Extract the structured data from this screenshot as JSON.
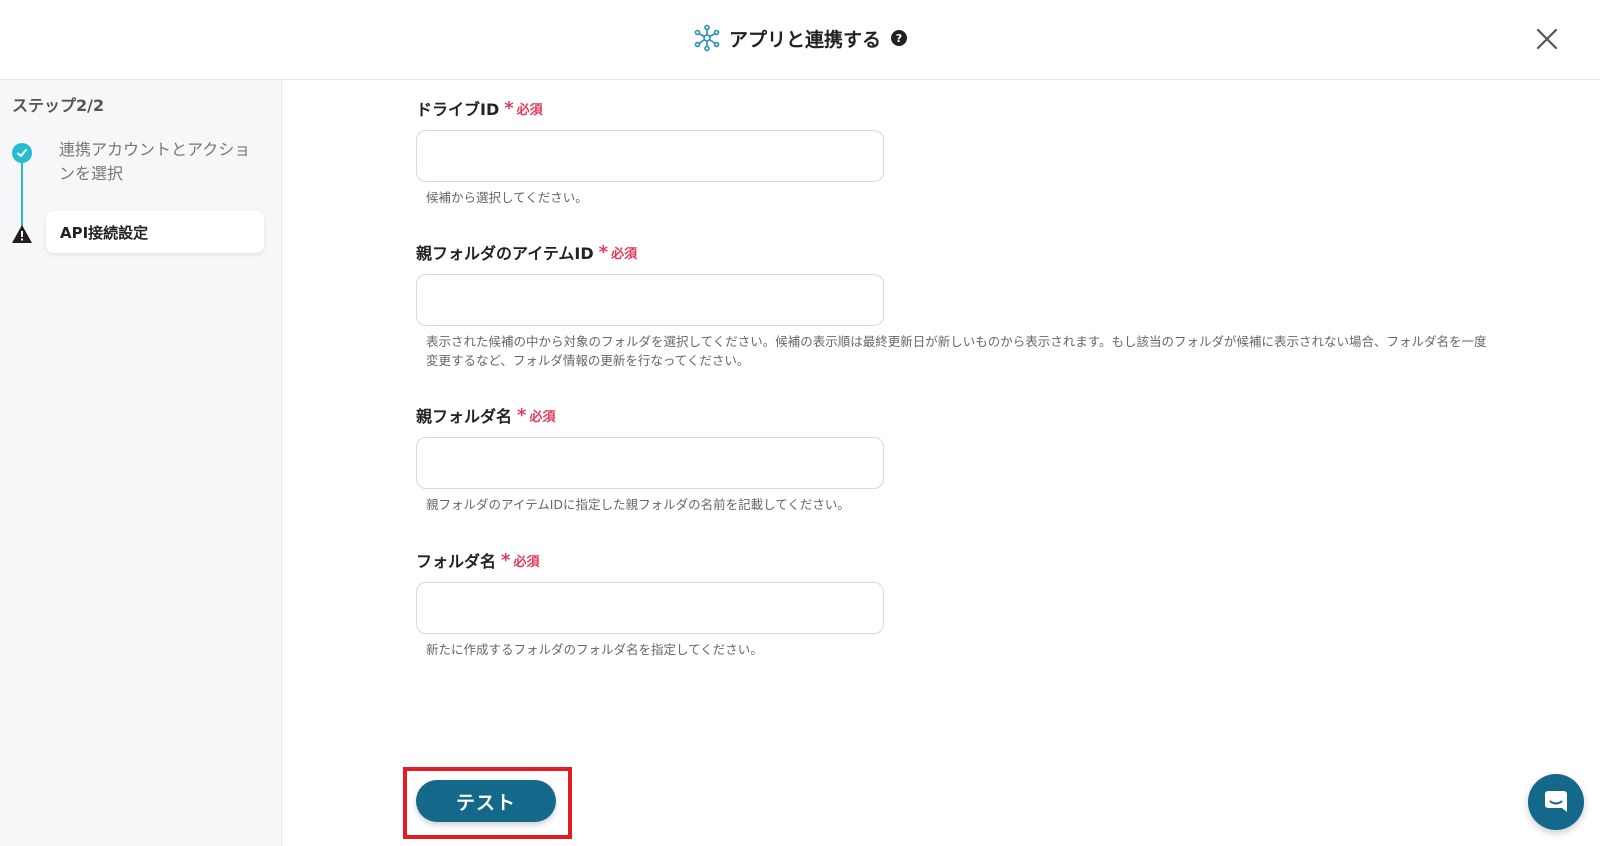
{
  "header": {
    "title": "アプリと連携する",
    "help_glyph": "?"
  },
  "sidebar": {
    "step_label": "ステップ2/2",
    "steps": [
      {
        "label": "連携アカウントとアクションを選択",
        "status": "done"
      },
      {
        "label": "API接続設定",
        "status": "warning"
      }
    ]
  },
  "form": {
    "required_text": "必須",
    "required_star": "*",
    "fields": [
      {
        "label": "ドライブID",
        "value": "",
        "help": "候補から選択してください。"
      },
      {
        "label": "親フォルダのアイテムID",
        "value": "",
        "help": "表示された候補の中から対象のフォルダを選択してください。候補の表示順は最終更新日が新しいものから表示されます。もし該当のフォルダが候補に表示されない場合、フォルダ名を一度変更するなど、フォルダ情報の更新を行なってください。"
      },
      {
        "label": "親フォルダ名",
        "value": "",
        "help": "親フォルダのアイテムIDに指定した親フォルダの名前を記載してください。"
      },
      {
        "label": "フォルダ名",
        "value": "",
        "help": "新たに作成するフォルダのフォルダ名を指定してください。"
      }
    ],
    "test_button": "テスト"
  },
  "colors": {
    "accent": "#14698b",
    "step_done": "#27bdd1",
    "required": "#e33b5b",
    "highlight": "#e31c25"
  },
  "icons": {
    "app": "network-hub-icon",
    "help": "question-circle-icon",
    "close": "close-icon",
    "done": "check-circle-icon",
    "warning": "warning-triangle-icon",
    "chat": "chat-bubble-icon"
  }
}
